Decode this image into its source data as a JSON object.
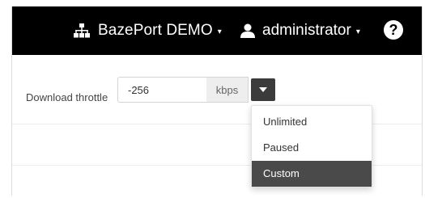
{
  "header": {
    "org_name": "BazePort DEMO",
    "org_icon": "sitemap-icon",
    "user_name": "administrator",
    "user_icon": "user-icon",
    "help_icon": "help-icon",
    "help_glyph": "?",
    "caret": "▾"
  },
  "throttle": {
    "label": "Download throttle",
    "value": "-256",
    "unit": "kbps"
  },
  "dropdown": {
    "options": [
      "Unlimited",
      "Paused",
      "Custom"
    ],
    "selected": "Custom"
  },
  "colors": {
    "topbar": "#000000",
    "active_option": "#4a4a4a"
  }
}
